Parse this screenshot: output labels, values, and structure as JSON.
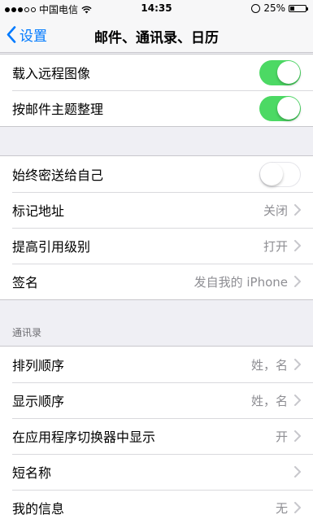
{
  "status_bar": {
    "carrier": "中国电信",
    "time": "14:35",
    "battery": "25%",
    "battery_level": 0.25
  },
  "nav": {
    "back_label": "设置",
    "title": "邮件、通讯录、日历"
  },
  "group1": {
    "row1": {
      "label": "载入远程图像",
      "toggle": true
    },
    "row2": {
      "label": "按邮件主题整理",
      "toggle": true
    }
  },
  "group2": {
    "row1": {
      "label": "始终密送给自己",
      "toggle": false
    },
    "row2": {
      "label": "标记地址",
      "value": "关闭"
    },
    "row3": {
      "label": "提高引用级别",
      "value": "打开"
    },
    "row4": {
      "label": "签名",
      "value": "发自我的 iPhone"
    }
  },
  "contacts": {
    "header": "通讯录",
    "row1": {
      "label": "排列顺序",
      "value": "姓，名"
    },
    "row2": {
      "label": "显示顺序",
      "value": "姓，名"
    },
    "row3": {
      "label": "在应用程序切换器中显示",
      "value": "开"
    },
    "row4": {
      "label": "短名称"
    },
    "row5": {
      "label": "我的信息",
      "value": "无"
    }
  },
  "colors": {
    "accent": "#007aff",
    "toggle_on": "#4cd964",
    "background": "#efeff4"
  }
}
